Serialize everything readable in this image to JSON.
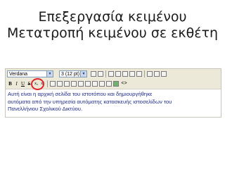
{
  "slide": {
    "title_line1": "Επεξεργασία κειμένου",
    "title_line2": "Μετατροπή κειμένου σε εκθέτη"
  },
  "toolbar": {
    "font_family": "Verdana",
    "font_size": "3 (12 pt)",
    "bold_label": "B",
    "italic_label": "I",
    "underline_label": "U",
    "strike_label": "S",
    "subscript_label": "x₂",
    "superscript_label": "x²",
    "code_label": "<>"
  },
  "editor": {
    "line1": "Αυτή είναι η αρχική σελίδα του ιστοτόπου και δημιουργήθηκε",
    "line2": "αυτόματα από την υπηρεσία αυτόματης κατασκευής ιστοσελίδων του",
    "line3": "Πανελλήνιου Σχολικού Δικτύου."
  },
  "colors": {
    "highlight_ring": "#e0252a",
    "editor_text": "#1e2a8a"
  }
}
